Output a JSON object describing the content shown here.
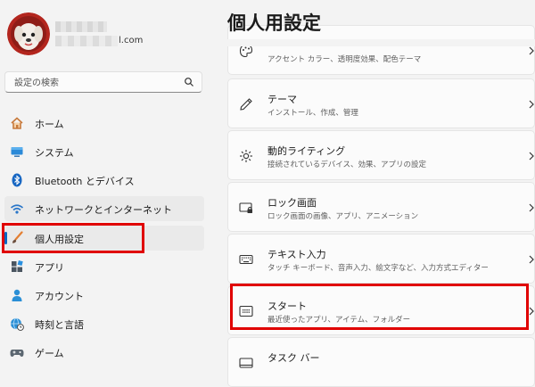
{
  "account": {
    "email_suffix": "l.com"
  },
  "search": {
    "placeholder": "設定の検索"
  },
  "nav": [
    {
      "label": "ホーム",
      "icon": "home-icon"
    },
    {
      "label": "システム",
      "icon": "monitor-icon"
    },
    {
      "label": "Bluetooth とデバイス",
      "icon": "bluetooth-icon"
    },
    {
      "label": "ネットワークとインターネット",
      "icon": "wifi-icon"
    },
    {
      "label": "個人用設定",
      "icon": "brush-icon"
    },
    {
      "label": "アプリ",
      "icon": "apps-icon"
    },
    {
      "label": "アカウント",
      "icon": "person-icon"
    },
    {
      "label": "時刻と言語",
      "icon": "globe-clock-icon"
    },
    {
      "label": "ゲーム",
      "icon": "gamepad-icon"
    }
  ],
  "main": {
    "title": "個人用設定",
    "cards": [
      {
        "title": "",
        "subtitle": "アクセント カラー、透明度効果、配色テーマ",
        "icon": "palette-icon"
      },
      {
        "title": "テーマ",
        "subtitle": "インストール、作成、管理",
        "icon": "pen-icon"
      },
      {
        "title": "動的ライティング",
        "subtitle": "接続されているデバイス、効果、アプリの設定",
        "icon": "sun-icon"
      },
      {
        "title": "ロック画面",
        "subtitle": "ロック画面の画像、アプリ、アニメーション",
        "icon": "lock-screen-icon"
      },
      {
        "title": "テキスト入力",
        "subtitle": "タッチ キーボード、音声入力、絵文字など、入力方式エディター",
        "icon": "keyboard-icon"
      },
      {
        "title": "スタート",
        "subtitle": "最近使ったアプリ、アイテム、フォルダー",
        "icon": "start-menu-icon"
      },
      {
        "title": "タスク バー",
        "subtitle": "",
        "icon": "taskbar-icon"
      }
    ]
  },
  "colors": {
    "accent": "#0067c0",
    "highlight_box": "#e00000"
  }
}
